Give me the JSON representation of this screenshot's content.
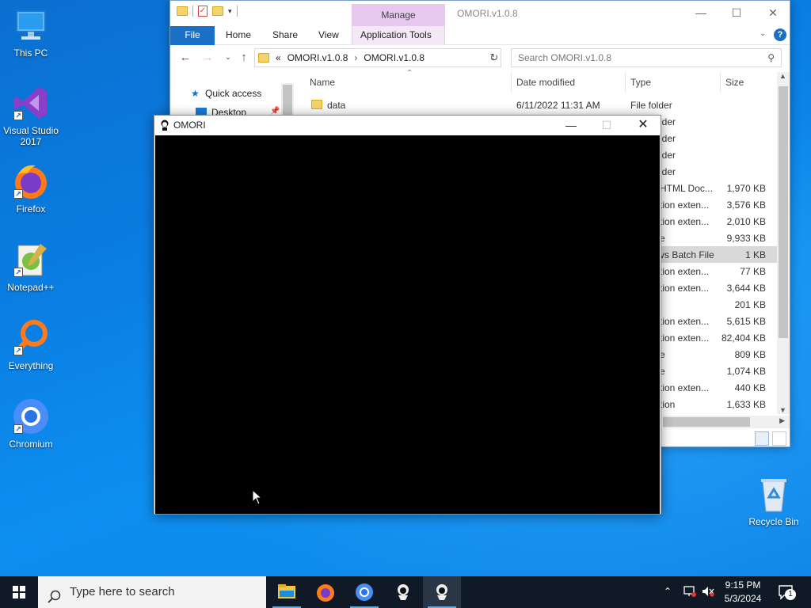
{
  "desktop": {
    "icons": [
      {
        "label": "This PC"
      },
      {
        "label": "Visual Studio 2017"
      },
      {
        "label": "Firefox"
      },
      {
        "label": "Notepad++"
      },
      {
        "label": "Everything"
      },
      {
        "label": "Chromium"
      },
      {
        "label": "Recycle Bin"
      }
    ]
  },
  "explorer": {
    "title": "OMORI.v1.0.8",
    "manage_tab": "Manage",
    "ribbon_tabs": [
      "File",
      "Home",
      "Share",
      "View",
      "Application Tools"
    ],
    "address": {
      "prefix": "«",
      "segments": [
        "OMORI.v1.0.8",
        "OMORI.v1.0.8"
      ]
    },
    "search_placeholder": "Search OMORI.v1.0.8",
    "nav_items": [
      "Quick access",
      "Desktop"
    ],
    "columns": [
      "Name",
      "Date modified",
      "Type",
      "Size"
    ],
    "first_row": {
      "name": "data",
      "date": "6/11/2022 11:31 AM",
      "type": "File folder"
    },
    "rows": [
      {
        "type": "lder",
        "size": ""
      },
      {
        "type": "lder",
        "size": ""
      },
      {
        "type": "lder",
        "size": ""
      },
      {
        "type": "lder",
        "size": ""
      },
      {
        "type": "HTML Doc...",
        "size": "1,970 KB"
      },
      {
        "type": "tion exten...",
        "size": "3,576 KB"
      },
      {
        "type": "tion exten...",
        "size": "2,010 KB"
      },
      {
        "type": "e",
        "size": "9,933 KB"
      },
      {
        "type": "vs Batch File",
        "size": "1 KB"
      },
      {
        "type": "tion exten...",
        "size": "77 KB"
      },
      {
        "type": "tion exten...",
        "size": "3,644 KB"
      },
      {
        "type": "",
        "size": "201 KB"
      },
      {
        "type": "tion exten...",
        "size": "5,615 KB"
      },
      {
        "type": "tion exten...",
        "size": "82,404 KB"
      },
      {
        "type": "e",
        "size": "809 KB"
      },
      {
        "type": "e",
        "size": "1,074 KB"
      },
      {
        "type": "tion exten...",
        "size": "440 KB"
      },
      {
        "type": "tion",
        "size": "1,633 KB"
      }
    ]
  },
  "omori_window": {
    "title": "OMORI"
  },
  "taskbar": {
    "search_placeholder": "Type here to search",
    "time": "9:15 PM",
    "date": "5/3/2024",
    "notification_count": "1"
  }
}
